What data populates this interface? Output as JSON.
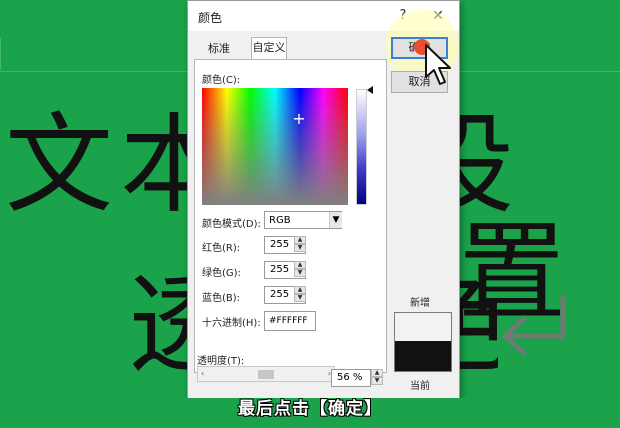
{
  "background": {
    "color": "#1aa34b"
  },
  "slide": {
    "text_line1_left": "文",
    "text_line1_mid": "本",
    "text_line1_right": "设置",
    "text_line2_left": "透",
    "text_line2_right": "色"
  },
  "dialog": {
    "title": "颜色",
    "help": "?",
    "close": "✕",
    "tabs": [
      {
        "label": "标准",
        "active": false
      },
      {
        "label": "自定义",
        "active": true
      }
    ],
    "colors_label": "颜色(C):",
    "color_model_label": "颜色模式(D):",
    "color_model_value": "RGB",
    "red_label": "红色(R):",
    "red_value": "255",
    "green_label": "绿色(G):",
    "green_value": "255",
    "blue_label": "蓝色(B):",
    "blue_value": "255",
    "hex_label": "十六进制(H):",
    "hex_value": "#FFFFFF",
    "ok_label": "确定",
    "cancel_label": "取消",
    "new_label": "新增",
    "current_label": "当前",
    "new_color": "#f2f2f2",
    "current_color": "#111111",
    "transparency_label": "透明度(T):",
    "transparency_value": "56 %"
  },
  "caption": "最后点击【确定】"
}
